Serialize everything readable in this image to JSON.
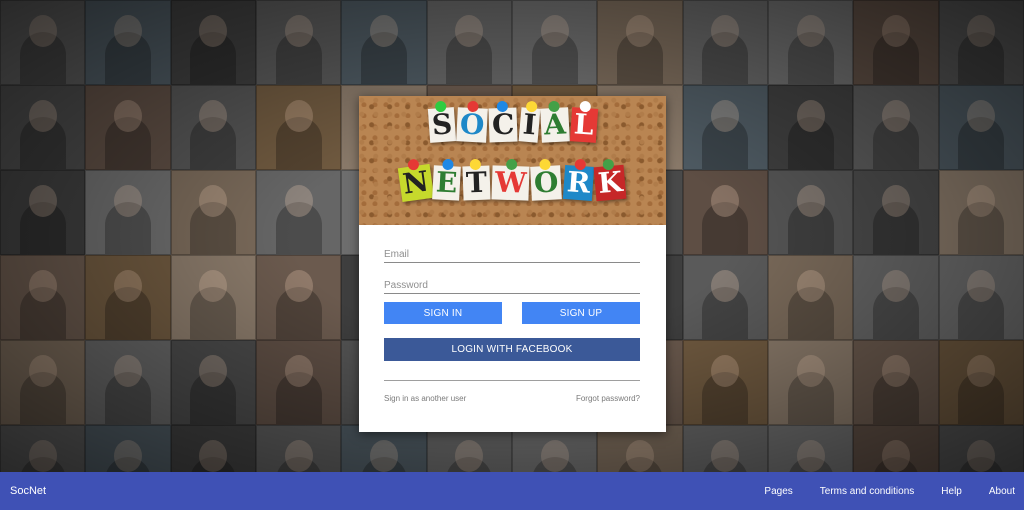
{
  "banner": {
    "line1": [
      "S",
      "O",
      "C",
      "I",
      "A",
      "L"
    ],
    "line2": [
      "N",
      "E",
      "T",
      "W",
      "O",
      "R",
      "K"
    ]
  },
  "login": {
    "email_placeholder": "Email",
    "password_placeholder": "Password",
    "sign_in_label": "SIGN IN",
    "sign_up_label": "SIGN UP",
    "facebook_label": "LOGIN WITH FACEBOOK",
    "another_user_link": "Sign in as another user",
    "forgot_password_link": "Forgot password?"
  },
  "footer": {
    "brand": "SocNet",
    "nav": [
      "Pages",
      "Terms and conditions",
      "Help",
      "About"
    ]
  },
  "colors": {
    "primary_button": "#4285f4",
    "facebook_button": "#3b5998",
    "footer_bar": "#3f51b5"
  }
}
